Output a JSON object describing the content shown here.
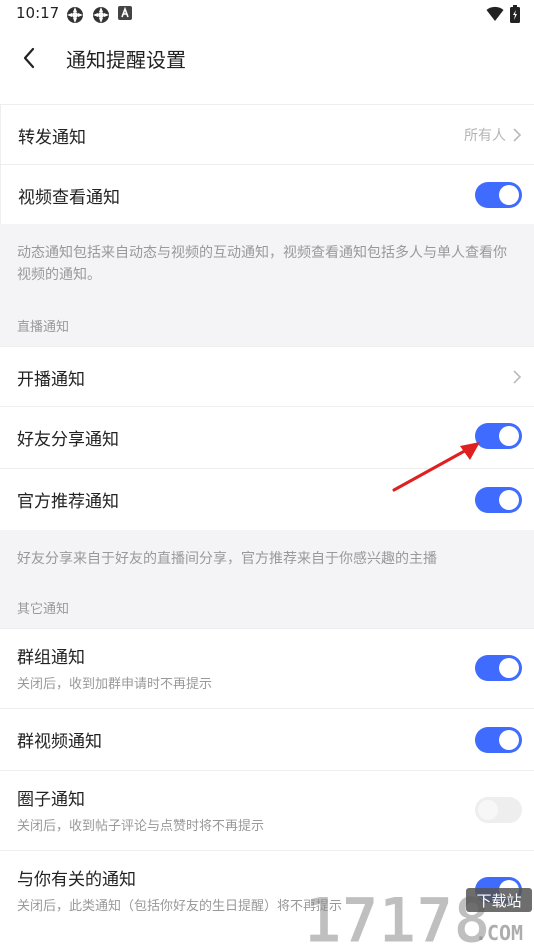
{
  "status": {
    "time": "10:17"
  },
  "header": {
    "title": "通知提醒设置"
  },
  "rows_top": [
    {
      "label": "转发通知",
      "value": "所有人"
    },
    {
      "label": "视频查看通知"
    }
  ],
  "note_top": "动态通知包括来自动态与视频的互动通知，视频查看通知包括多人与单人查看你视频的通知。",
  "live_section": {
    "title": "直播通知",
    "rows": [
      {
        "label": "开播通知"
      },
      {
        "label": "好友分享通知"
      },
      {
        "label": "官方推荐通知"
      }
    ],
    "note": "好友分享来自于好友的直播间分享，官方推荐来自于你感兴趣的主播"
  },
  "other_section": {
    "title": "其它通知",
    "rows": [
      {
        "label": "群组通知",
        "sub": "关闭后，收到加群申请时不再提示",
        "on": true
      },
      {
        "label": "群视频通知",
        "on": true
      },
      {
        "label": "圈子通知",
        "sub": "关闭后，收到帖子评论与点赞时将不再提示",
        "on": false
      },
      {
        "label": "与你有关的通知",
        "sub": "关闭后，此类通知（包括你好友的生日提醒）将不再提示",
        "on": true
      }
    ]
  },
  "watermark": {
    "number": "17178",
    "badge": "下载站",
    "domain": ".COM"
  },
  "colors": {
    "accent": "#3f6bff",
    "annotation_arrow": "#e02020"
  }
}
